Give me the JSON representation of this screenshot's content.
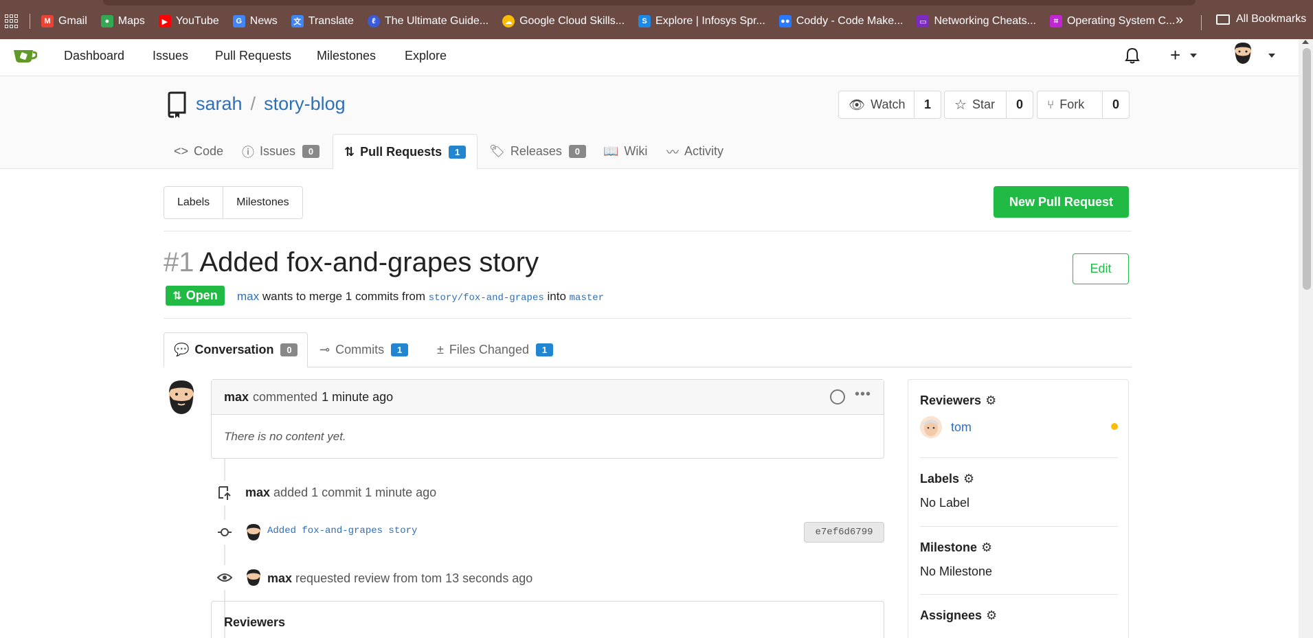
{
  "bookmarks": {
    "items": [
      {
        "label": "Gmail",
        "icon": "gmail-icon",
        "color": "#ea4335"
      },
      {
        "label": "Maps",
        "icon": "maps-icon",
        "color": "#34a853"
      },
      {
        "label": "YouTube",
        "icon": "youtube-icon",
        "color": "#ff0000"
      },
      {
        "label": "News",
        "icon": "news-icon",
        "color": "#4285f4"
      },
      {
        "label": "Translate",
        "icon": "translate-icon",
        "color": "#4285f4"
      },
      {
        "label": "The Ultimate Guide...",
        "icon": "guide-icon",
        "color": "#3b5bdb"
      },
      {
        "label": "Google Cloud Skills...",
        "icon": "cloud-icon",
        "color": "#fbbc04"
      },
      {
        "label": "Explore | Infosys Spr...",
        "icon": "infosys-icon",
        "color": "#1e88e5"
      },
      {
        "label": "Coddy - Code Make...",
        "icon": "coddy-icon",
        "color": "#2979ff"
      },
      {
        "label": "Networking Cheats...",
        "icon": "network-icon",
        "color": "#7b2cbf"
      },
      {
        "label": "Operating System C...",
        "icon": "os-icon",
        "color": "#c026d3"
      }
    ],
    "more": "»",
    "all_bookmarks": "All Bookmarks"
  },
  "nav": {
    "items": [
      "Dashboard",
      "Issues",
      "Pull Requests",
      "Milestones",
      "Explore"
    ]
  },
  "repo": {
    "owner": "sarah",
    "name": "story-blog",
    "watch_label": "Watch",
    "watch_count": "1",
    "star_label": "Star",
    "star_count": "0",
    "fork_label": "Fork",
    "fork_count": "0"
  },
  "tabs": {
    "code": "Code",
    "issues": "Issues",
    "issues_count": "0",
    "pulls": "Pull Requests",
    "pulls_count": "1",
    "releases": "Releases",
    "releases_count": "0",
    "wiki": "Wiki",
    "activity": "Activity"
  },
  "filters": {
    "labels": "Labels",
    "milestones": "Milestones"
  },
  "new_pr_label": "New Pull Request",
  "pr": {
    "number": "#1",
    "title": "Added fox-and-grapes story",
    "edit_label": "Edit",
    "status": "Open",
    "author": "max",
    "merge_text": "wants to merge 1 commits from",
    "head_branch": "story/fox-and-grapes",
    "into_text": "into",
    "base_branch": "master"
  },
  "pr_tabs": {
    "conversation": "Conversation",
    "conversation_count": "0",
    "commits": "Commits",
    "commits_count": "1",
    "files": "Files Changed",
    "files_count": "1"
  },
  "timeline": {
    "comment_author": "max",
    "comment_action": "commented",
    "comment_time": "1 minute ago",
    "comment_body": "There is no content yet.",
    "commit_event_author": "max",
    "commit_event_text": "added 1 commit 1 minute ago",
    "commit_message": "Added fox-and-grapes story",
    "commit_sha": "e7ef6d6799",
    "review_author": "max",
    "review_text": "requested review from tom 13 seconds ago",
    "reviewers_heading": "Reviewers"
  },
  "sidebar": {
    "reviewers_heading": "Reviewers",
    "reviewer": "tom",
    "labels_heading": "Labels",
    "labels_value": "No Label",
    "milestone_heading": "Milestone",
    "milestone_value": "No Milestone",
    "assignees_heading": "Assignees"
  },
  "colors": {
    "accent": "#21ba45",
    "link": "#2f6fb6",
    "badge_blue": "#2185d0",
    "pending": "#fbbd08"
  }
}
